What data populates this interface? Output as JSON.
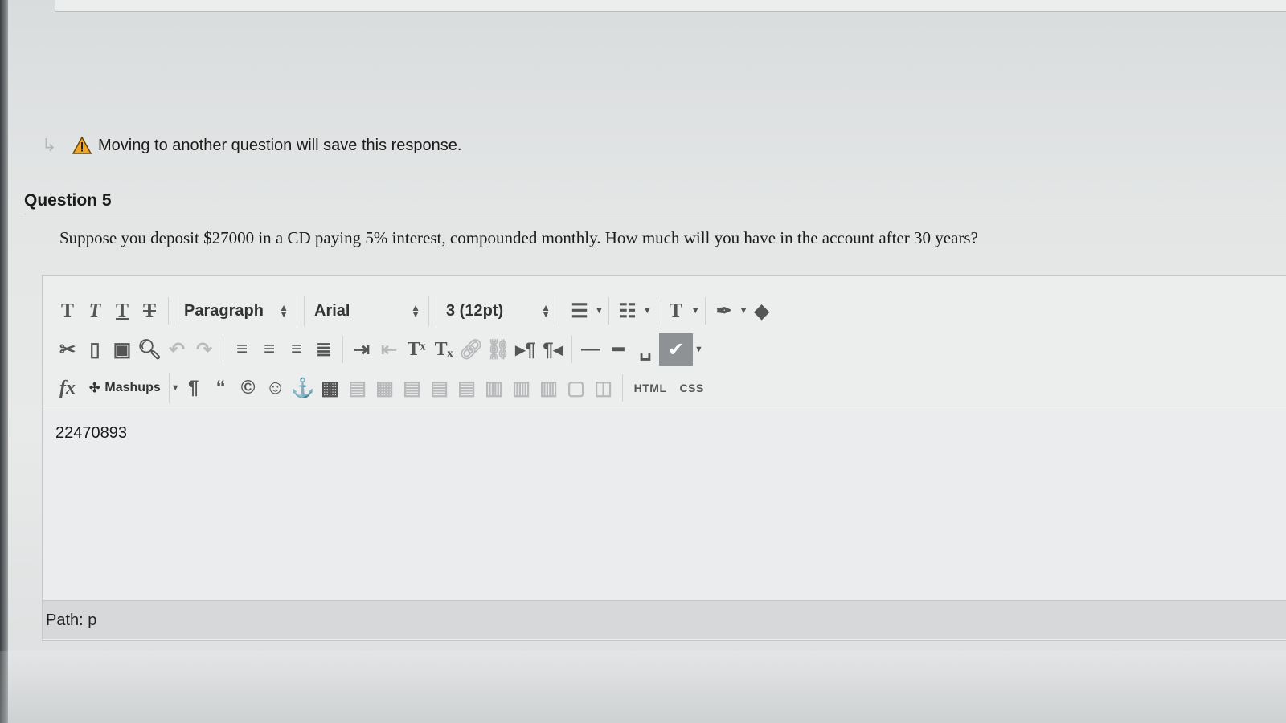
{
  "notice": {
    "text": "Moving to another question will save this response."
  },
  "question": {
    "title": "Question 5",
    "prompt": "Suppose you deposit $27000 in a CD paying 5% interest, compounded monthly. How much will you have in the account after 30 years?"
  },
  "toolbar": {
    "format_select": "Paragraph",
    "font_select": "Arial",
    "size_select": "3 (12pt)",
    "mashups_label": "Mashups",
    "html_label": "HTML",
    "css_label": "CSS"
  },
  "editor": {
    "content": "22470893",
    "path_label": "Path:",
    "path_value": "p"
  }
}
